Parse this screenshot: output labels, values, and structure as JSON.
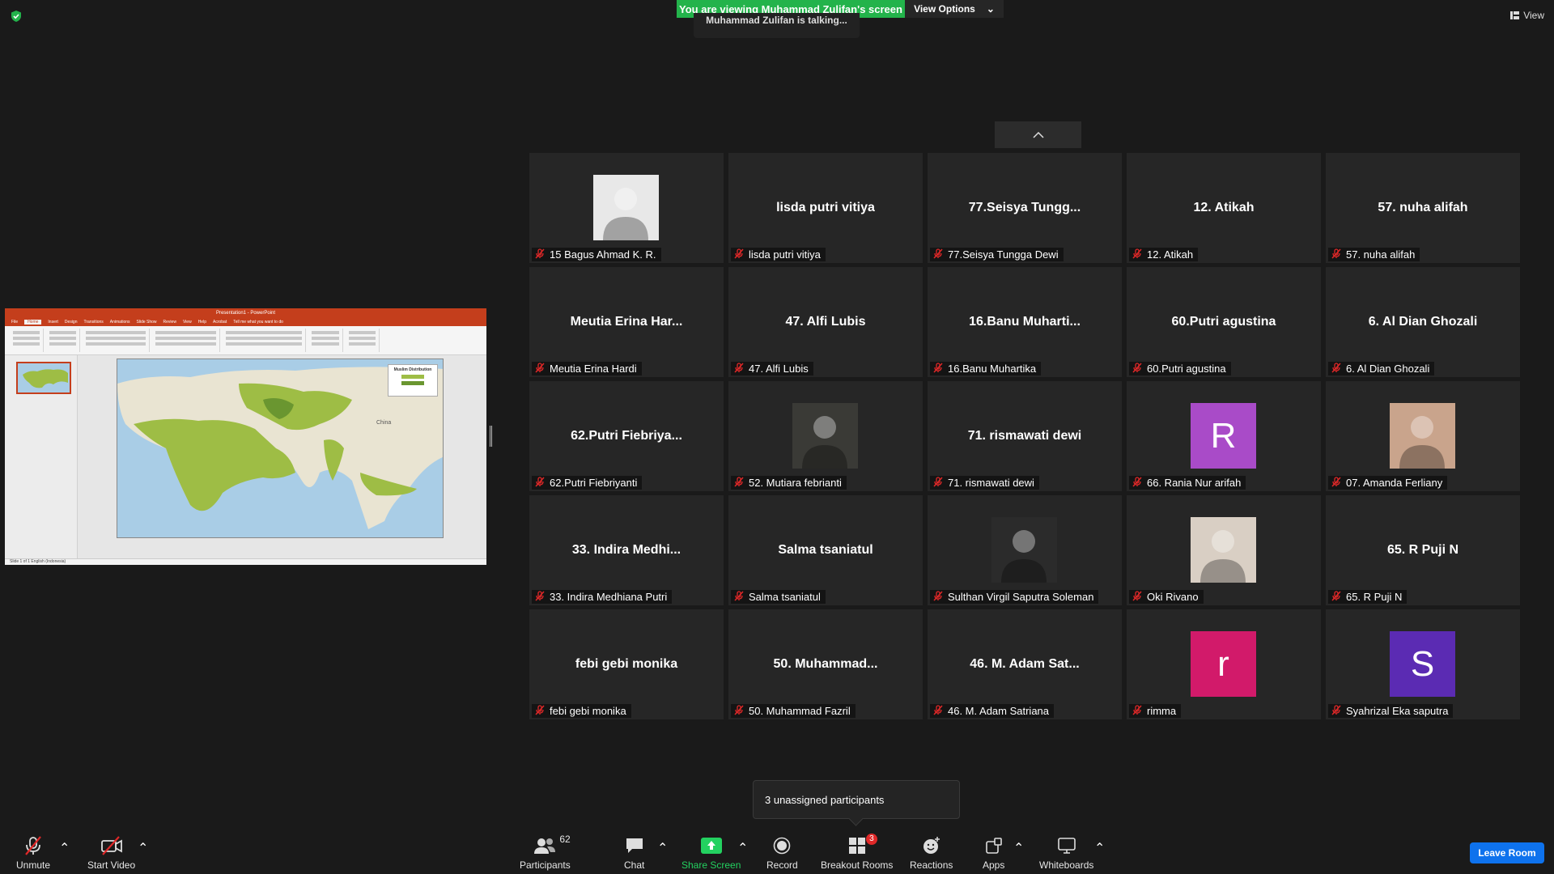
{
  "banner": {
    "viewing": "You are viewing Muhammad Zulifan's screen",
    "view_options": "View Options",
    "talking": "Muhammad Zulifan is talking...",
    "view": "View"
  },
  "shared_screen": {
    "app_title": "Presentation1 - PowerPoint",
    "tabs": [
      "File",
      "Home",
      "Insert",
      "Design",
      "Transitions",
      "Animations",
      "Slide Show",
      "Review",
      "View",
      "Help",
      "Acrobat",
      "Tell me what you want to do"
    ],
    "legend_title": "Muslim Distribution",
    "status": "Slide 1 of 1    English (Indonesia)"
  },
  "participants": [
    {
      "big": "",
      "label": "15 Bagus Ahmad K. R.",
      "avatar_type": "image",
      "avatar_color": "#e8e8e8"
    },
    {
      "big": "lisda putri vitiya",
      "label": "lisda putri vitiya"
    },
    {
      "big": "77.Seisya  Tungg...",
      "label": "77.Seisya Tungga Dewi"
    },
    {
      "big": "12. Atikah",
      "label": "12. Atikah"
    },
    {
      "big": "57. nuha alifah",
      "label": "57. nuha alifah"
    },
    {
      "big": "Meutia Erina Har...",
      "label": "Meutia Erina Hardi"
    },
    {
      "big": "47. Alfi Lubis",
      "label": "47. Alfi Lubis"
    },
    {
      "big": "16.Banu  Muharti...",
      "label": "16.Banu Muhartika"
    },
    {
      "big": "60.Putri agustina",
      "label": "60.Putri agustina"
    },
    {
      "big": "6. Al Dian Ghozali",
      "label": "6. Al Dian Ghozali"
    },
    {
      "big": "62.Putri  Fiebriya...",
      "label": "62.Putri Fiebriyanti"
    },
    {
      "big": "",
      "label": "52. Mutiara febrianti",
      "avatar_type": "image",
      "avatar_color": "#3a3a36"
    },
    {
      "big": "71. rismawati dewi",
      "label": "71. rismawati dewi"
    },
    {
      "big": "",
      "label": "66. Rania Nur arifah",
      "avatar_type": "letter",
      "avatar_letter": "R",
      "avatar_color": "#a94bc8"
    },
    {
      "big": "",
      "label": "07. Amanda Ferliany",
      "avatar_type": "image",
      "avatar_color": "#c9a48c"
    },
    {
      "big": "33. Indira Medhi...",
      "label": "33. Indira Medhiana Putri"
    },
    {
      "big": "Salma tsaniatul",
      "label": "Salma tsaniatul"
    },
    {
      "big": "",
      "label": "Sulthan Virgil Saputra Soleman",
      "avatar_type": "image",
      "avatar_color": "#2b2b2b"
    },
    {
      "big": "",
      "label": "Oki Rivano",
      "avatar_type": "image",
      "avatar_color": "#d9cfc4"
    },
    {
      "big": "65. R Puji N",
      "label": "65. R Puji N"
    },
    {
      "big": "febi gebi monika",
      "label": "febi gebi monika"
    },
    {
      "big": "50.  Muhammad...",
      "label": "50. Muhammad Fazril"
    },
    {
      "big": "46. M. Adam Sat...",
      "label": "46. M. Adam Satriana"
    },
    {
      "big": "",
      "label": "rimma",
      "avatar_type": "letter",
      "avatar_letter": "r",
      "avatar_color": "#d21a6a"
    },
    {
      "big": "",
      "label": "Syahrizal Eka saputra",
      "avatar_type": "letter",
      "avatar_letter": "S",
      "avatar_color": "#5b2bb3"
    }
  ],
  "popup": {
    "unassigned": "3 unassigned participants"
  },
  "toolbar": {
    "unmute": "Unmute",
    "start_video": "Start Video",
    "participants": "Participants",
    "participants_count": "62",
    "chat": "Chat",
    "share_screen": "Share Screen",
    "record": "Record",
    "breakout_rooms": "Breakout Rooms",
    "breakout_badge": "3",
    "reactions": "Reactions",
    "apps": "Apps",
    "whiteboards": "Whiteboards",
    "leave": "Leave Room"
  },
  "colors": {
    "share_green": "#23b34b",
    "leave_blue": "#0e72ed",
    "muted_red": "#e02828"
  }
}
